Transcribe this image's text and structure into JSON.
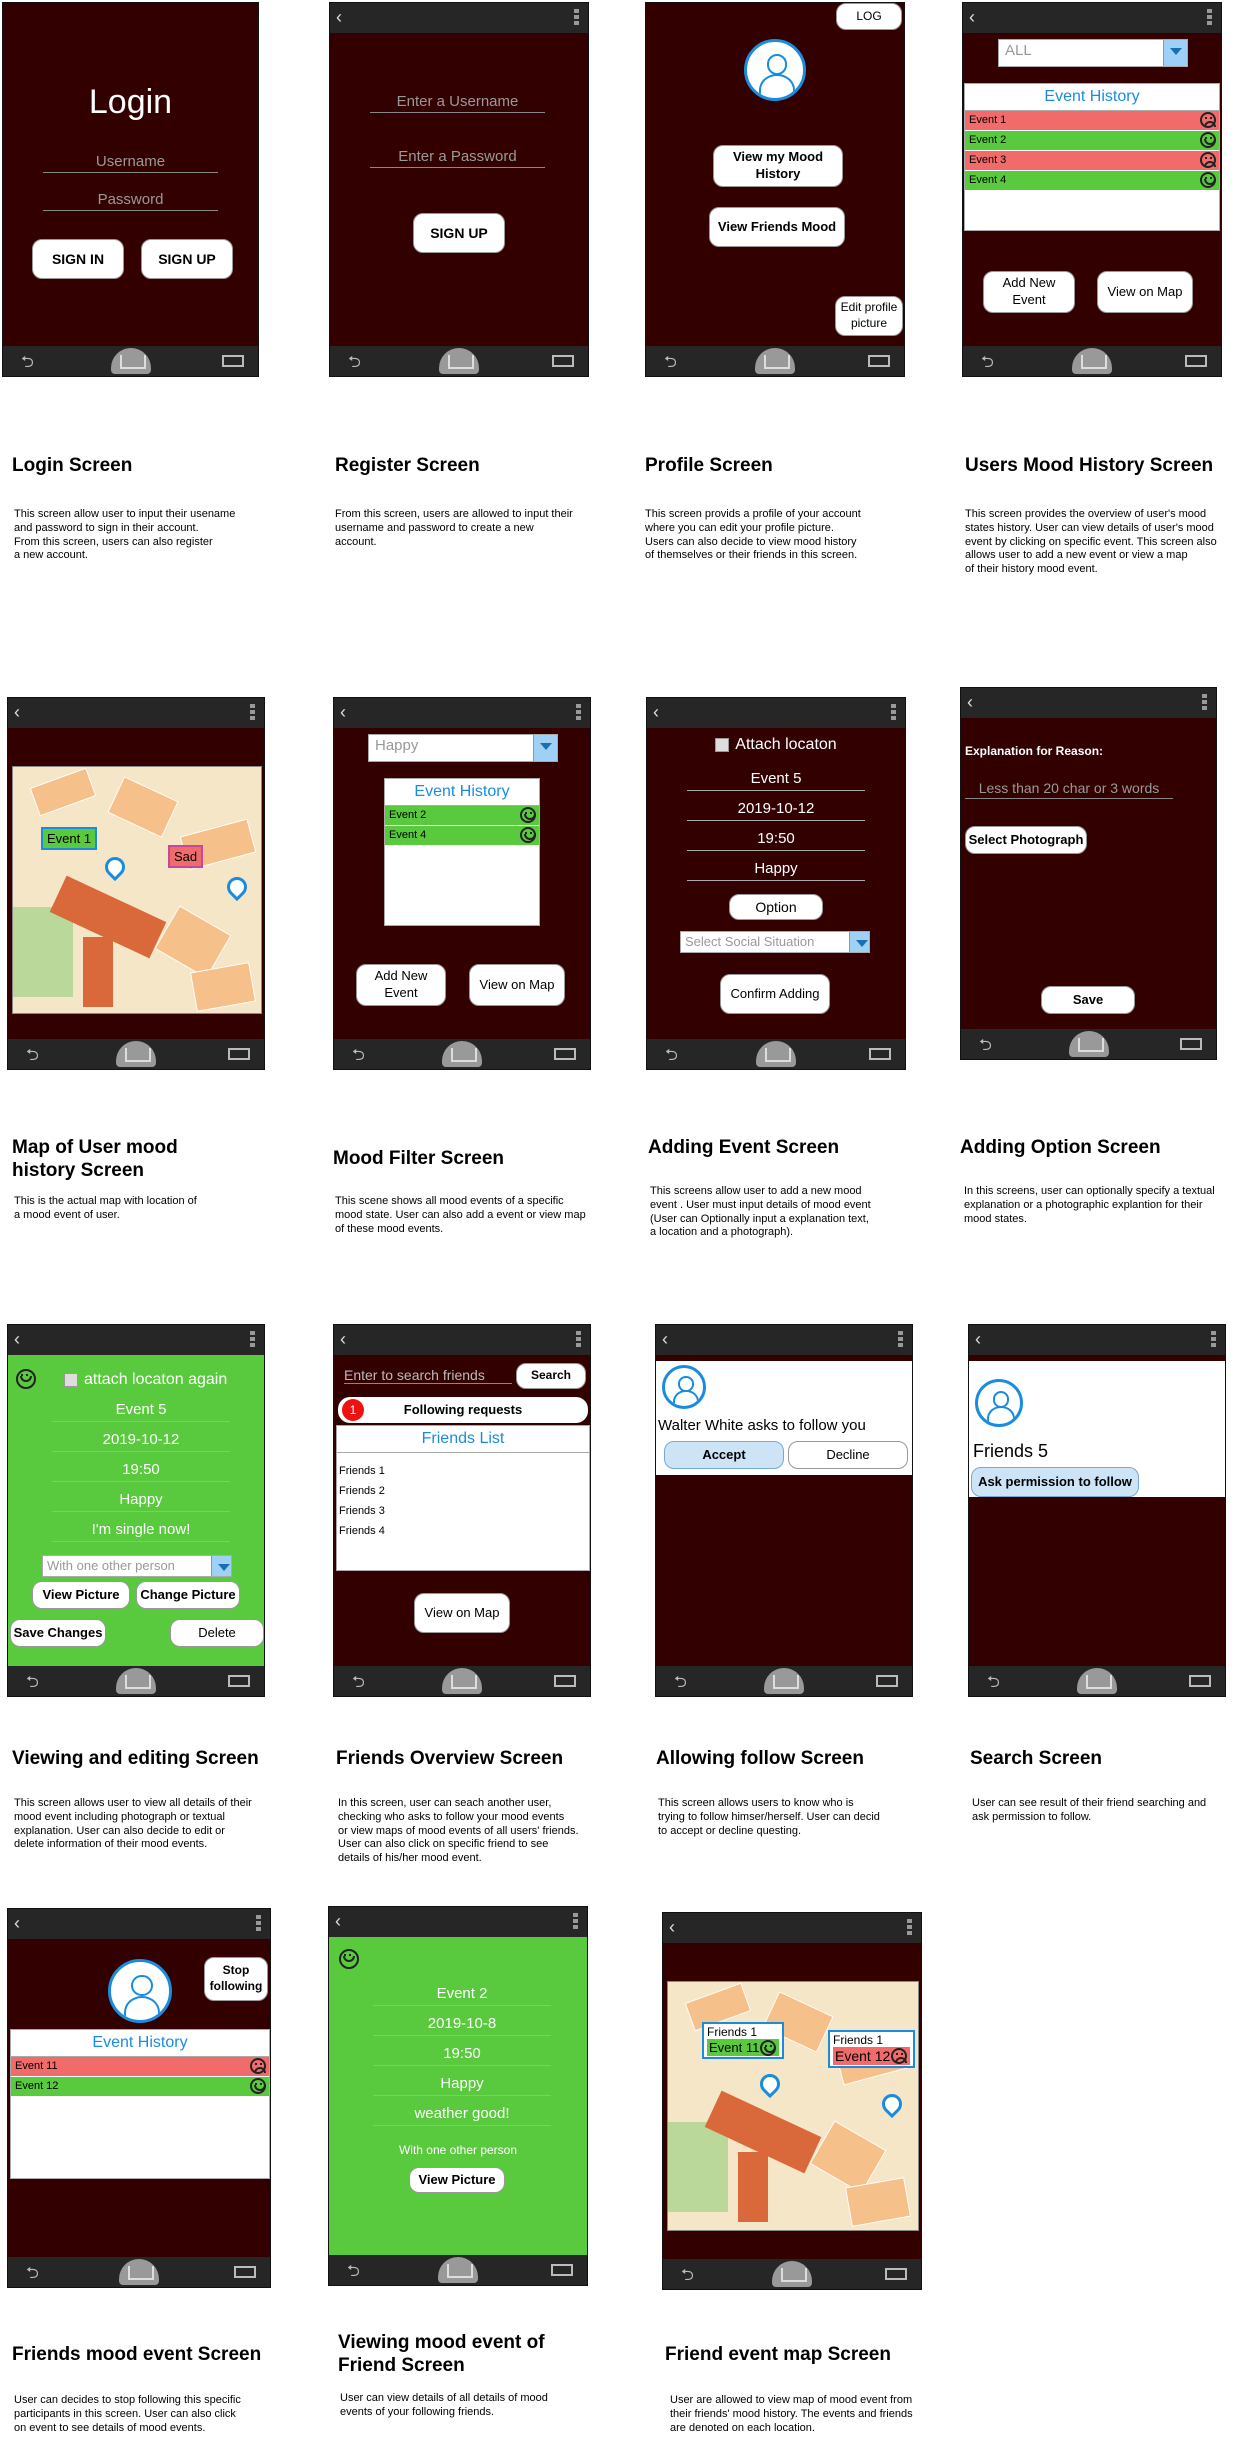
{
  "screens": {
    "login": {
      "heading": "Login",
      "username_placeholder": "Username",
      "password_placeholder": "Password",
      "sign_in": "SIGN IN",
      "sign_up": "SIGN UP",
      "title": "Login Screen",
      "desc": "This screen allow user to input their usename\nand password to sign in their account.\nFrom this screen, users can also register\n a new account."
    },
    "register": {
      "username_placeholder": "Enter a Username",
      "password_placeholder": "Enter a Password",
      "sign_up": "SIGN UP",
      "title": "Register Screen",
      "desc": "From this screen, users are allowed to input their\nusername and password to create a new\naccount."
    },
    "profile": {
      "log": "LOG",
      "view_history": "View my Mood\nHistory",
      "view_friends": "View Friends Mood",
      "edit_picture": "Edit profile\npicture",
      "title": "Profile Screen",
      "desc": "This screen provids a profile of your account\nwhere you can edit your profile picture.\nUsers can also decide to view mood history\n of themselves or their friends in this screen."
    },
    "history": {
      "filter_value": "ALL",
      "list_title": "Event History",
      "events": [
        {
          "label": "Event 1",
          "mood": "sad"
        },
        {
          "label": "Event 2",
          "mood": "happy"
        },
        {
          "label": "Event 3",
          "mood": "sad"
        },
        {
          "label": "Event 4",
          "mood": "happy"
        }
      ],
      "add_event": "Add New\nEvent",
      "view_map": "View on Map",
      "title": "Users Mood History Screen",
      "desc": "This screen provides the overview of user's mood\nstates history. User can view details of user's mood\nevent by clicking on specific event. This screen also\nallows user to add a new event or view a map\nof their history mood event."
    },
    "map": {
      "tag1": "Event 1",
      "tag2": "Sad",
      "title": "Map of User mood\nhistory Screen",
      "desc": "This is the actual map with location of\na mood event of user."
    },
    "filter": {
      "filter_value": "Happy",
      "list_title": "Event History",
      "events": [
        {
          "label": "Event 2",
          "mood": "happy"
        },
        {
          "label": "Event 4",
          "mood": "happy"
        }
      ],
      "add_event": "Add New\nEvent",
      "view_map": "View on Map",
      "title": "Mood Filter Screen",
      "desc": "This scene shows all mood events of a specific\nmood state. User can also add a event or view map\nof these mood events."
    },
    "adding": {
      "attach": "Attach locaton",
      "event": "Event 5",
      "date": "2019-10-12",
      "time": "19:50",
      "mood": "Happy",
      "option": "Option",
      "social_placeholder": "Select Social Situation",
      "confirm": "Confirm Adding",
      "title": "Adding Event Screen",
      "desc": "This screens allow user to add a new mood\nevent . User must input details of mood event\n(User can Optionally input a explanation text,\na location and a photograph)."
    },
    "option": {
      "label": "Explanation for Reason:",
      "placeholder": "Less than 20 char or 3 words",
      "select_photo": "Select Photograph",
      "save": "Save",
      "title": "Adding Option Screen",
      "desc": "In this screens, user can optionally specify a textual\nexplanation or a photographic explantion for their\nmood states."
    },
    "viewing": {
      "attach": "attach locaton again",
      "event": "Event 5",
      "date": "2019-10-12",
      "time": "19:50",
      "mood": "Happy",
      "reason": "I'm single now!",
      "social": "With one other person",
      "view_picture": "View Picture",
      "change_picture": "Change Picture",
      "save": "Save Changes",
      "delete": "Delete",
      "title": "Viewing and editing Screen",
      "desc": "This screen allows user to view all details of their\nmood event including photograph or textual\nexplanation. User can also decide to edit or\ndelete information of their mood events."
    },
    "friends": {
      "search_placeholder": "Enter to search friends",
      "search": "Search",
      "badge": "1",
      "requests": "Following requests",
      "list_title": "Friends List",
      "items": [
        "Friends 1",
        "Friends 2",
        "Friends 3",
        "Friends 4"
      ],
      "view_map": "View on Map",
      "title": "Friends Overview Screen",
      "desc": "In this screen, user can seach another user,\nchecking who asks to follow your mood events\nor view maps of mood events of all users' friends.\nUser can also click on specific friend to see\ndetails of his/her mood event."
    },
    "follow": {
      "message": "Walter White asks to follow you",
      "accept": "Accept",
      "decline": "Decline",
      "title": "Allowing follow Screen",
      "desc": "This screen allows users to know who is\ntrying to follow himser/herself. User can decid\nto accept or decline questing."
    },
    "search": {
      "name": "Friends 5",
      "ask": "Ask permission to follow",
      "title": "Search Screen",
      "desc": "User can see result of their friend searching and\nask permission to follow."
    },
    "friend_event": {
      "stop": "Stop\nfollowing",
      "list_title": "Event History",
      "events": [
        {
          "label": "Event 11",
          "mood": "sad"
        },
        {
          "label": "Event 12",
          "mood": "happy"
        }
      ],
      "title": "Friends mood event Screen",
      "desc": "User can decides to stop following this specific\nparticipants in this screen. User can also click\non event to see details of mood events."
    },
    "friend_view": {
      "event": "Event 2",
      "date": "2019-10-8",
      "time": "19:50",
      "mood": "Happy",
      "reason": "weather good!",
      "social": "With one other person",
      "view_picture": "View Picture",
      "title": "Viewing mood event of\nFriend  Screen",
      "desc": "User can view details of  all details of mood\nevents of your following friends."
    },
    "friend_map": {
      "tag1_name": "Friends 1",
      "tag1_event": "Event 11",
      "tag2_name": "Friends 1",
      "tag2_event": "Event 12",
      "title": "Friend event map Screen",
      "desc": "User are allowed to view map of mood event from\ntheir friends' mood history. The events and friends\nare denoted on each location."
    }
  },
  "colors": {
    "phone_bg": "#330000",
    "accent": "#1a8ce0",
    "happy": "#59c93d",
    "sad": "#f26b6b"
  }
}
